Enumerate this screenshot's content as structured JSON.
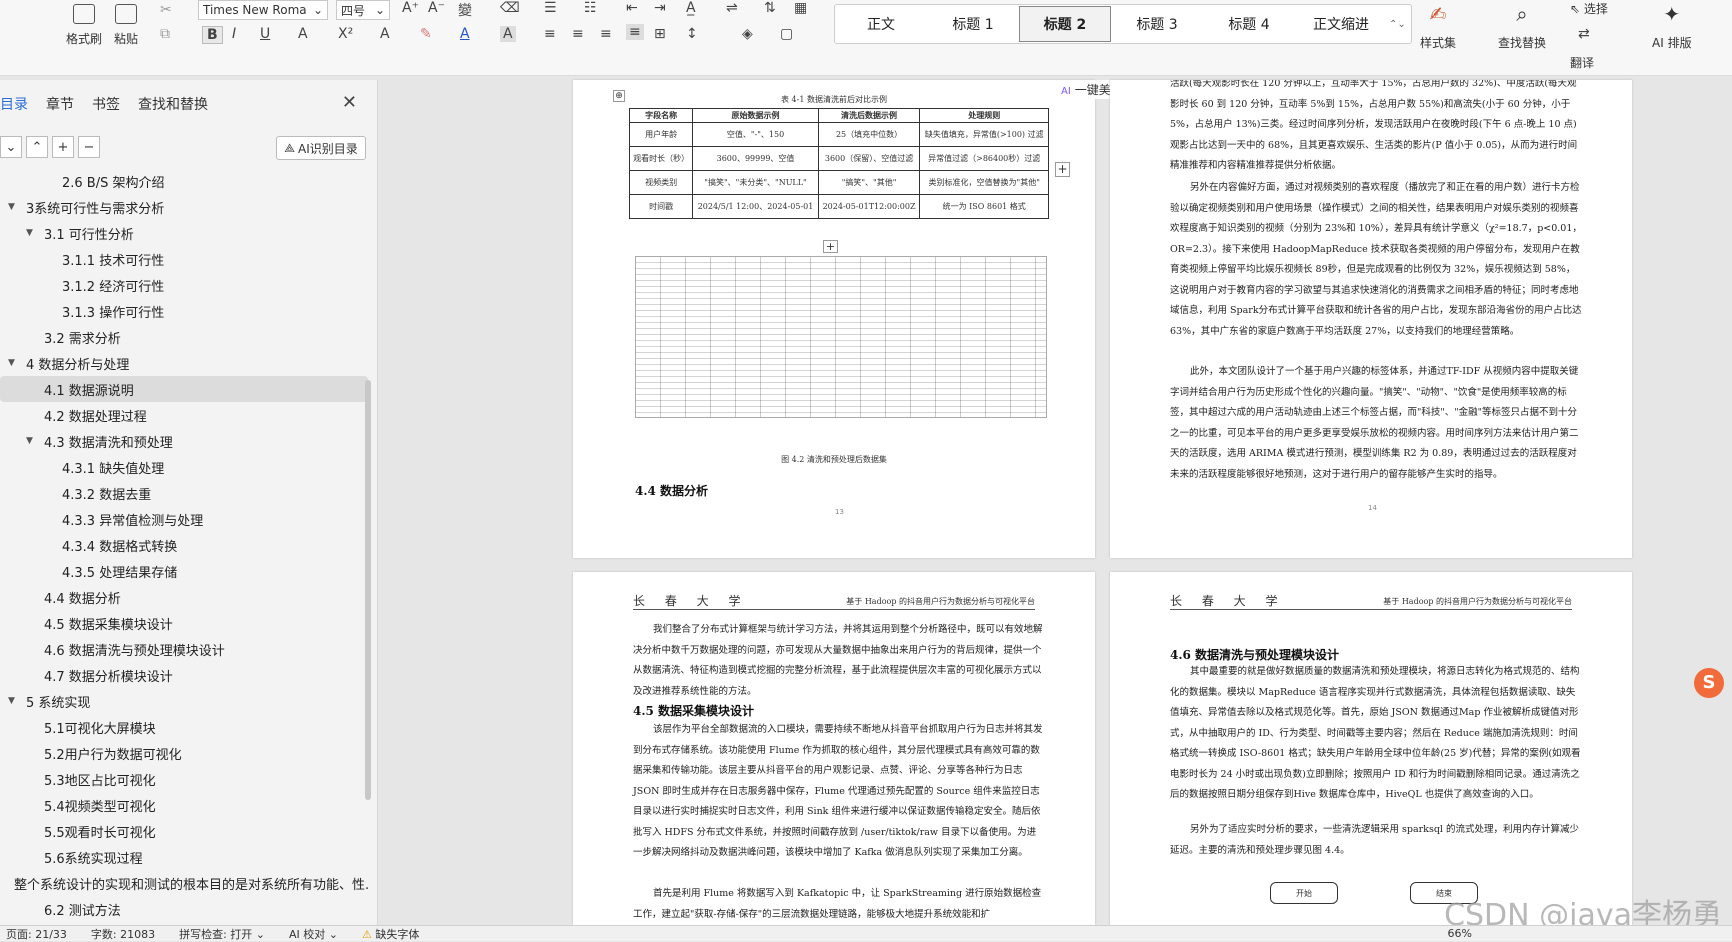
{
  "ribbon": {
    "format_painter": "格式刷",
    "paste": "粘贴",
    "font_name": "Times New Roma",
    "font_size": "四号",
    "styles": [
      "正文",
      "标题 1",
      "标题 2",
      "标题 3",
      "标题 4",
      "正文缩进"
    ],
    "active_style": "标题 2",
    "style_set": "样式集",
    "find_replace": "查找替换",
    "select": "选择",
    "translate": "翻译",
    "ai_layout": "AI 排版"
  },
  "nav": {
    "tabs": [
      "目录",
      "章节",
      "书签",
      "查找和替换"
    ],
    "ai_toc": "AI识别目录",
    "items": [
      {
        "label": "2.6 B/S 架构介绍",
        "level": 2,
        "tri": ""
      },
      {
        "label": "3系统可行性与需求分析",
        "level": 0,
        "tri": "▼"
      },
      {
        "label": "3.1 可行性分析",
        "level": 1,
        "tri": "▼"
      },
      {
        "label": "3.1.1 技术可行性",
        "level": 2,
        "tri": ""
      },
      {
        "label": "3.1.2 经济可行性",
        "level": 2,
        "tri": ""
      },
      {
        "label": "3.1.3 操作可行性",
        "level": 2,
        "tri": ""
      },
      {
        "label": "3.2 需求分析",
        "level": 1,
        "tri": ""
      },
      {
        "label": "4 数据分析与处理",
        "level": 0,
        "tri": "▼"
      },
      {
        "label": "4.1 数据源说明",
        "level": 1,
        "tri": "",
        "active": true
      },
      {
        "label": "4.2 数据处理过程",
        "level": 1,
        "tri": ""
      },
      {
        "label": "4.3 数据清洗和预处理",
        "level": 1,
        "tri": "▼"
      },
      {
        "label": "4.3.1 缺失值处理",
        "level": 2,
        "tri": ""
      },
      {
        "label": "4.3.2 数据去重",
        "level": 2,
        "tri": ""
      },
      {
        "label": "4.3.3 异常值检测与处理",
        "level": 2,
        "tri": ""
      },
      {
        "label": "4.3.4 数据格式转换",
        "level": 2,
        "tri": ""
      },
      {
        "label": "4.3.5 处理结果存储",
        "level": 2,
        "tri": ""
      },
      {
        "label": "4.4 数据分析",
        "level": 1,
        "tri": ""
      },
      {
        "label": "4.5 数据采集模块设计",
        "level": 1,
        "tri": ""
      },
      {
        "label": "4.6 数据清洗与预处理模块设计",
        "level": 1,
        "tri": ""
      },
      {
        "label": "4.7 数据分析模块设计",
        "level": 1,
        "tri": ""
      },
      {
        "label": "5 系统实现",
        "level": 0,
        "tri": "▼"
      },
      {
        "label": "5.1可视化大屏模块",
        "level": 1,
        "tri": ""
      },
      {
        "label": "5.2用户行为数据可视化",
        "level": 1,
        "tri": ""
      },
      {
        "label": "5.3地区占比可视化",
        "level": 1,
        "tri": ""
      },
      {
        "label": "5.4视频类型可视化",
        "level": 1,
        "tri": ""
      },
      {
        "label": "5.5观看时长可视化",
        "level": 1,
        "tri": ""
      },
      {
        "label": "5.6系统实现过程",
        "level": 1,
        "tri": ""
      },
      {
        "label": "整个系统设计的实现和测试的根本目的是对系统所有功能、性...",
        "level": 0,
        "tri": ""
      },
      {
        "label": "6.2 测试方法",
        "level": 1,
        "tri": ""
      }
    ]
  },
  "beautify": "一键美化",
  "page1": {
    "table_caption": "表 4-1 数据清洗前后对比示例",
    "headers": [
      "字段名称",
      "原始数据示例",
      "清洗后数据示例",
      "处理规则"
    ],
    "rows": [
      [
        "用户年龄",
        "空值、\"-\"、150",
        "25（填充中位数）",
        "缺失值填充，异常值(>100) 过滤"
      ],
      [
        "观看时长（秒）",
        "3600、99999、空值",
        "3600（保留）、空值过滤",
        "异常值过滤（>86400秒）过滤"
      ],
      [
        "视频类别",
        "\"搞笑\"、\"未分类\"、\"NULL\"",
        "\"搞笑\"、\"其他\"",
        "类别标准化，空值替换为\"其他\""
      ],
      [
        "时间戳",
        "2024/5/1 12:00、2024-05-01",
        "2024-05-01T12:00:00Z",
        "统一为 ISO 8601 格式"
      ]
    ],
    "figure_caption": "图 4.2 清洗和预处理后数据集",
    "heading": "4.4  数据分析",
    "page_no": "13"
  },
  "page2": {
    "paragraphs": [
      "活跃(每天观影时长在 120 分钟以上，互动率大于 15%，占总用户数的 32%)、中度活跃(每天观影时长 60 到 120 分钟，互动率 5%到 15%，占总用户数 55%)和高流失(小于 60 分钟，小于 5%，占总用户 13%)三类。经过时间序列分析，发现活跃用户在夜晚时段(下午 6 点-晚上 10 点)观影占比达到一天中的 68%，且其更喜欢娱乐、生活类的影片(P 值小于 0.05)，从而为进行时间精准推荐和内容精准推荐提供分析依据。",
      "另外在内容偏好方面，通过对视频类别的喜欢程度（播放完了和正在看的用户数）进行卡方检验以确定视频类别和用户使用场景（操作模式）之间的相关性，结果表明用户对娱乐类别的视频喜欢程度高于知识类别的视频（分别为 23%和 10%），差异具有统计学意义（χ²=18.7，p<0.01，OR=2.3）。接下来使用 HadoopMapReduce 技术获取各类视频的用户停留分布，发现用户在教育类视频上停留平均比娱乐视频长 89秒，但是完成观看的比例仅为 32%，娱乐视频达到 58%，这说明用户对于教育内容的学习欲望与其追求快速消化的消费需求之间相矛盾的特征；同时考虑地域信息，利用 Spark分布式计算平台获取和统计各省的用户占比，发现东部沿海省份的用户占比达 63%，其中广东省的家庭户数高于平均活跃度 27%，以支持我们的地理经营策略。",
      "此外，本文团队设计了一个基于用户兴趣的标签体系，并通过TF-IDF 从视频内容中提取关键字词并结合用户行为历史形成个性化的兴趣向量。\"搞笑\"、\"动物\"、\"饮食\"是使用频率较高的标签，其中超过六成的用户活动轨迹由上述三个标签占据，而\"科技\"、\"金融\"等标签只占据不到十分之一的比重，可见本平台的用户更多更享受娱乐放松的视频内容。用时间序列方法来估计用户第二天的活跃度，选用 ARIMA 模式进行预测，模型训练集 R2 为 0.89，表明通过过去的活跃程度对未来的活跃程度能够很好地预测，这对于进行用户的留存能够产生实时的指导。"
    ],
    "page_no": "14"
  },
  "page3": {
    "school": "长 春 大 学",
    "run_title": "基于 Hadoop 的抖音用户行为数据分析与可视化平台",
    "intro": "我们整合了分布式计算框架与统计学习方法，并将其运用到整个分析路径中，既可以有效地解决分析中数千万数据处理的问题，亦可发现从大量数据中抽象出来用户行为的背后规律，提供一个从数据清洗、特征构造到模式挖掘的完整分析流程，基于此流程提供层次丰富的可视化展示方式以及改进推荐系统性能的方法。",
    "heading": "4.5  数据采集模块设计",
    "body": "该层作为平台全部数据流的入口模块，需要持续不断地从抖音平台抓取用户行为日志并将其发到分布式存储系统。该功能使用 Flume 作为抓取的核心组件，其分层代理模式具有高效可靠的数据采集和传输功能。该层主要从抖音平台的用户观影记录、点赞、评论、分享等各种行为日志 JSON 即时生成并存在日志服务器中保存，Flume 代理通过预先配置的 Source 组件来监控日志目录以进行实时捕捉实时日志文件，利用 Sink 组件来进行缓冲以保证数据传输稳定安全。随后依批写入 HDFS 分布式文件系统，并按照时间戳存放到 /user/tiktok/raw 目录下以备使用。为进一步解决网络抖动及数据洪峰问题，该模块中增加了 Kafka 做消息队列实现了采集加工分离。",
    "body2": "首先是利用 Flume 将数据写入到 Kafkatopic 中，让 SparkStreaming 进行原始数据检查工作，建立起\"获取-存储-保存\"的三层流数据处理链路，能够极大地提升系统效能和扩"
  },
  "page4": {
    "school": "长 春 大 学",
    "run_title": "基于 Hadoop 的抖音用户行为数据分析与可视化平台",
    "heading": "4.6  数据清洗与预处理模块设计",
    "body": "其中最重要的就是做好数据质量的数据清洗和预处理模块，将源日志转化为格式规范的、结构化的数据集。模块以 MapReduce 语言程序实现并行式数据清洗，具体流程包括数据读取、缺失值填充、异常值去除以及格式规范化等。首先，原始 JSON 数据通过Map 作业被解析成键值对形式，从中抽取用户的 ID、行为类型、时间戳等主要内容；然后在 Reduce 端施加清洗规则：时间格式统一转换成 ISO-8601 格式；缺失用户年龄用全球中位年龄(25 岁)代替；异常的案例(如观看电影时长为 24 小时或出现负数)立即删除；按照用户 ID 和行为时间戳删除相同记录。通过清洗之后的数据按照日期分组保存到Hive 数据库仓库中，HiveQL 也提供了高效查询的入口。",
    "body2": "另外为了适应实时分析的要求，一些清洗逻辑采用 sparksql 的流式处理，利用内存计算减少延迟。主要的清洗和预处理步骤见图 4.4。",
    "flow_start": "开始",
    "flow_end": "结束"
  },
  "status": {
    "page": "页面: 21/33",
    "words": "字数: 21083",
    "spell": "拼写检查: 打开 ⌄",
    "ai_check": "AI 校对 ⌄",
    "missing_font": "缺失字体",
    "zoom": "66%"
  },
  "watermark": "CSDN @java李杨勇",
  "colors": {
    "accent": "#2b6fd6",
    "nav_bg": "#f3f3f3",
    "canvas_bg": "#e6e6e6"
  }
}
